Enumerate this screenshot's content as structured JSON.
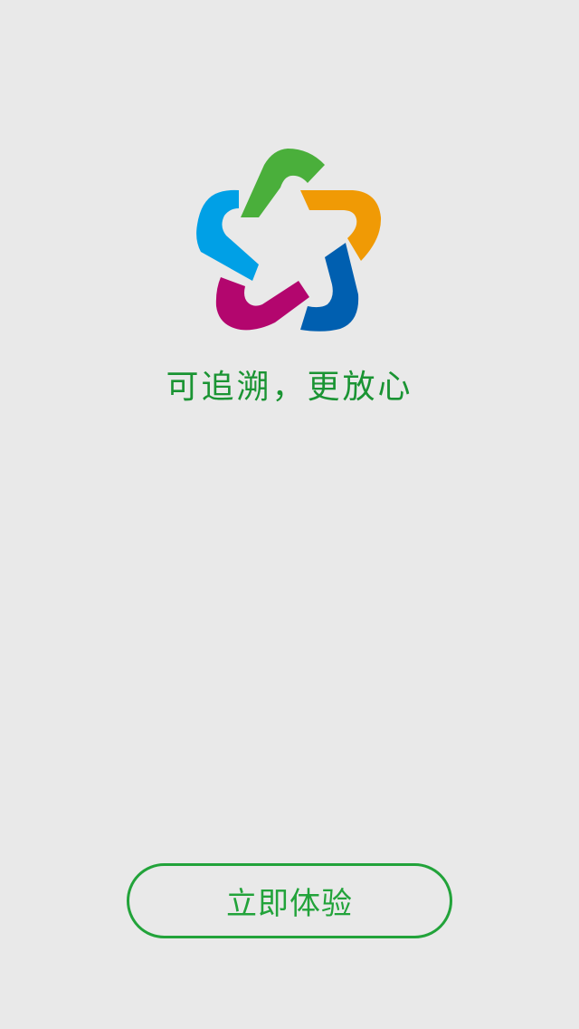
{
  "brand": {
    "logo_icon": "five-petal-star-logo-icon",
    "colors": {
      "green": "#4aaf3b",
      "orange": "#f09a05",
      "blue": "#005fb0",
      "magenta": "#b3066e",
      "cyan": "#00a0e6"
    }
  },
  "tagline": {
    "text": "可追溯，更放心",
    "color": "#1a9433"
  },
  "cta": {
    "label": "立即体验",
    "color": "#22a33a"
  },
  "background": "#e9e9e9"
}
